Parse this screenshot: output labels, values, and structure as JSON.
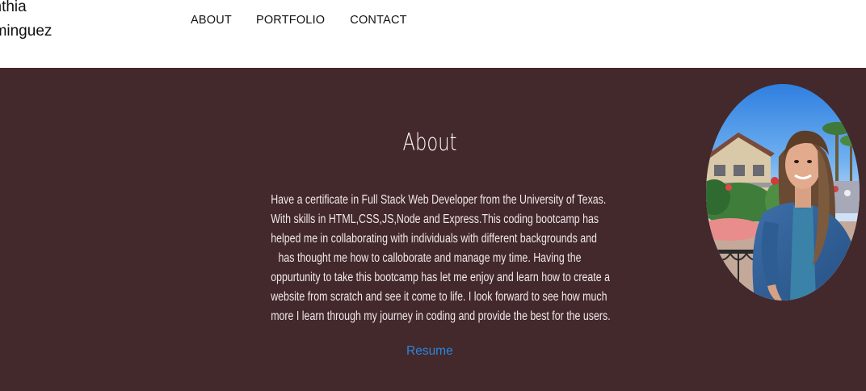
{
  "header": {
    "brand_line1": "ynthia",
    "brand_line2": "ominguez",
    "nav": {
      "about": "ABOUT",
      "portfolio": "PORTFOLIO",
      "contact": "CONTACT"
    }
  },
  "about": {
    "title": "About",
    "paragraph_lines": [
      "Have a certificate in Full Stack Web Developer from the University of Texas.",
      "With skills in HTML,CSS,JS,Node and Express.This coding bootcamp has",
      "helped me in collaborating with individuals with different backgrounds and",
      "has thought me how to calloborate and manage my time. Having the",
      "oppurtunity to take this bootcamp has let me enjoy and learn how to create a",
      "website from scratch and see it come to life. I look forward to see how much",
      "more I learn through my journey in coding and provide the best for the users."
    ],
    "resume_label": "Resume"
  },
  "colors": {
    "section_background": "#43282c",
    "link": "#2d86d9",
    "header_background": "#ffffff"
  }
}
